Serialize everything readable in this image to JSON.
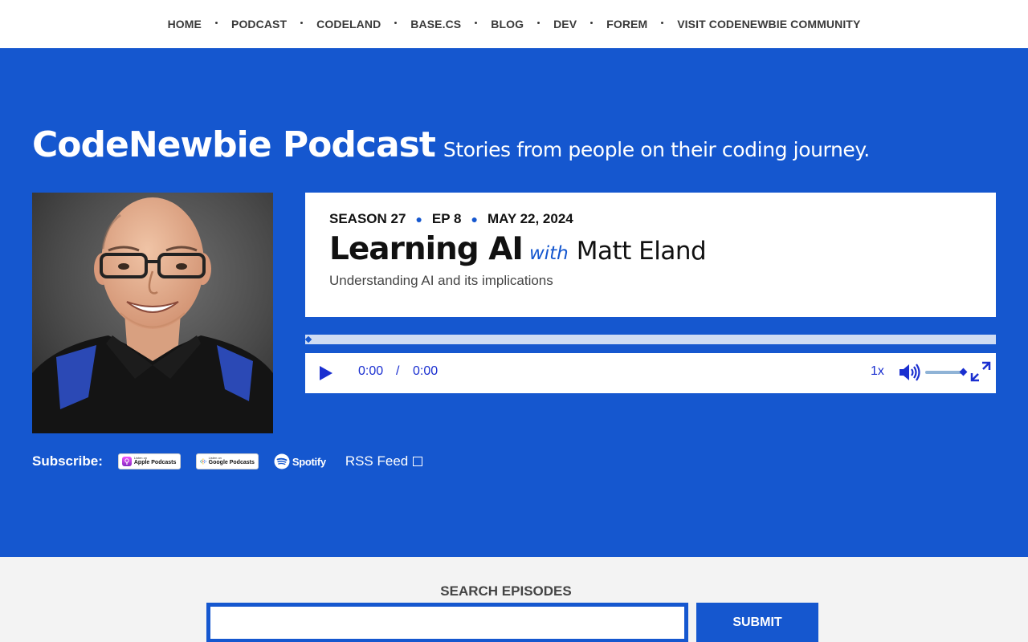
{
  "nav": {
    "items": [
      {
        "label": "HOME"
      },
      {
        "label": "PODCAST"
      },
      {
        "label": "CODELAND"
      },
      {
        "label": "BASE.CS"
      },
      {
        "label": "BLOG"
      },
      {
        "label": "DEV"
      },
      {
        "label": "FOREM"
      },
      {
        "label": "VISIT CODENEWBIE COMMUNITY"
      }
    ]
  },
  "hero": {
    "title": "CodeNewbie Podcast",
    "tagline": "Stories from people on their coding journey."
  },
  "episode": {
    "season": "SEASON 27",
    "episode": "EP 8",
    "date": "MAY 22, 2024",
    "title": "Learning AI",
    "with": "with",
    "guest": "Matt Eland",
    "subtitle": "Understanding AI and its implications"
  },
  "player": {
    "current_time": "0:00",
    "separator": "/",
    "duration": "0:00",
    "rate": "1x",
    "progress": 0,
    "volume": 1.0,
    "icons": [
      "play-icon",
      "volume-icon",
      "fullscreen-icon"
    ]
  },
  "subscribe": {
    "label": "Subscribe:",
    "apple": {
      "small": "Listen on",
      "big": "Apple Podcasts"
    },
    "google": {
      "small": "Listen on",
      "big": "Google Podcasts"
    },
    "spotify": "Spotify",
    "rss": "RSS Feed"
  },
  "search": {
    "title": "SEARCH EPISODES",
    "placeholder": "",
    "submit_label": "SUBMIT"
  },
  "colors": {
    "brand_blue": "#1557cf",
    "player_blue": "#1a2fd0",
    "search_bg": "#f3f3f3"
  }
}
